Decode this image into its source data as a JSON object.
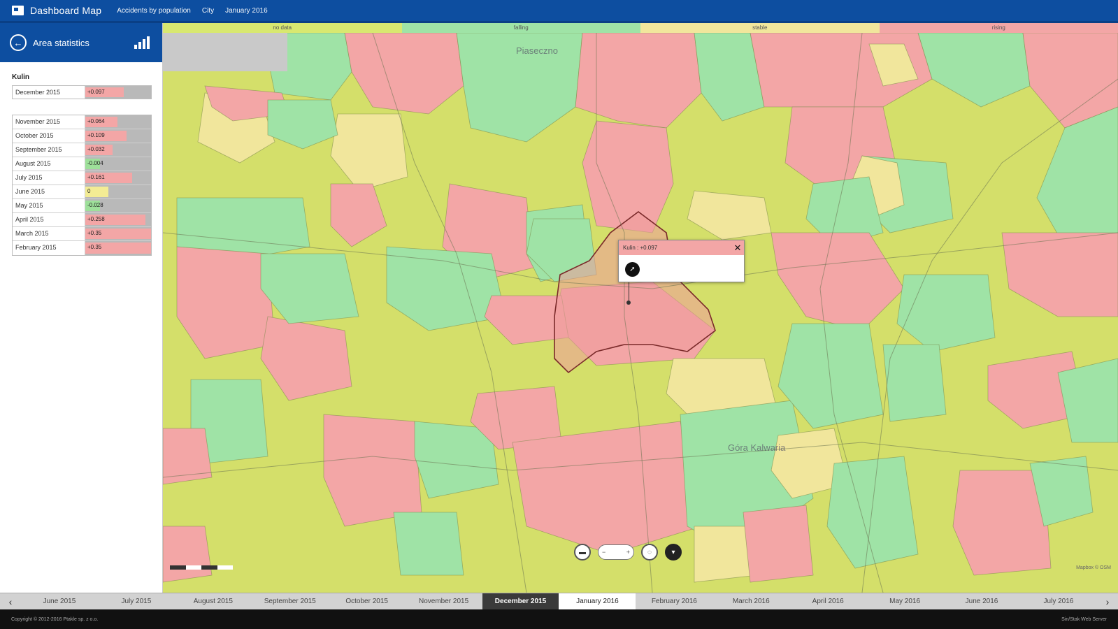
{
  "header": {
    "app_title": "Dashboard Map",
    "crumbs": [
      "Accidents by population",
      "City",
      "January 2016"
    ]
  },
  "sidebar": {
    "title": "Area statistics",
    "area_name": "Kulin",
    "current": {
      "label": "December 2015",
      "value": "+0.097",
      "fraction": 0.58,
      "color": "#f3a6a6"
    },
    "history": [
      {
        "label": "November 2015",
        "value": "+0.064",
        "fraction": 0.49,
        "color": "#f3a6a6"
      },
      {
        "label": "October 2015",
        "value": "+0.109",
        "fraction": 0.63,
        "color": "#f3a6a6"
      },
      {
        "label": "September 2015",
        "value": "+0.032",
        "fraction": 0.41,
        "color": "#f3a6a6"
      },
      {
        "label": "August 2015",
        "value": "-0.004",
        "fraction": 0.22,
        "color": "#9ee09a"
      },
      {
        "label": "July 2015",
        "value": "+0.161",
        "fraction": 0.71,
        "color": "#f3a6a6"
      },
      {
        "label": "June 2015",
        "value": "0",
        "fraction": 0.35,
        "color": "#f3ec94"
      },
      {
        "label": "May 2015",
        "value": "-0.028",
        "fraction": 0.22,
        "color": "#9ee09a"
      },
      {
        "label": "April 2015",
        "value": "+0.258",
        "fraction": 0.92,
        "color": "#f3a6a6"
      },
      {
        "label": "March 2015",
        "value": "+0.35",
        "fraction": 1.0,
        "color": "#f3a6a6"
      },
      {
        "label": "February 2015",
        "value": "+0.35",
        "fraction": 1.0,
        "color": "#f3a6a6"
      }
    ]
  },
  "legend": [
    {
      "label": "no data",
      "color": "#d8e870"
    },
    {
      "label": "falling",
      "color": "#9fe3a6"
    },
    {
      "label": "stable",
      "color": "#f1e69c"
    },
    {
      "label": "rising",
      "color": "#f3a6a6"
    }
  ],
  "map": {
    "labels": [
      "Piaseczno",
      "Góra Kalwaria"
    ],
    "popup": {
      "title": "Kulin : +0.097"
    },
    "attribution": "Mapbox © OSM"
  },
  "timeline": {
    "prev_icon": "‹",
    "next_icon": "›",
    "months": [
      "June 2015",
      "July 2015",
      "August 2015",
      "September 2015",
      "October 2015",
      "November 2015",
      "December 2015",
      "January 2016",
      "February 2016",
      "March 2016",
      "April 2016",
      "May 2016",
      "June 2016",
      "July 2016"
    ],
    "active_index": 6,
    "next_index": 7
  },
  "footer": {
    "copyright": "Copyright © 2012-2016 Ptakle sp. z o.o.",
    "right": "Sin/Stak Web Server"
  },
  "colors": {
    "header": "#0d4ea0",
    "rising": "#f3a6a6",
    "falling": "#9fe3a6",
    "stable": "#f1e69c",
    "nodata": "#d8e870"
  }
}
